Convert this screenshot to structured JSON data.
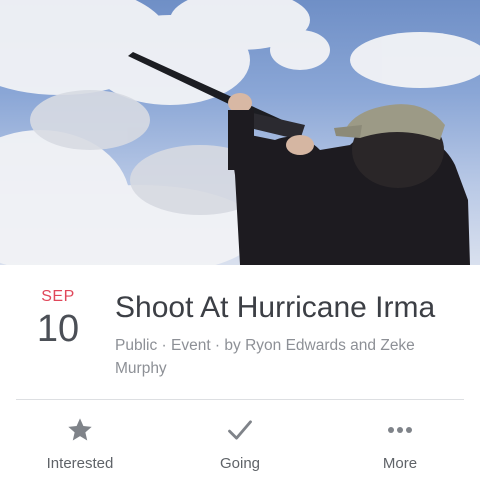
{
  "event": {
    "month": "SEP",
    "day": "10",
    "title": "Shoot At Hurricane Irma",
    "meta": "Public · Event · by Ryon Edwards and Zeke Murphy"
  },
  "actions": [
    {
      "label": "Interested",
      "icon": "star-icon"
    },
    {
      "label": "Going",
      "icon": "checkmark-icon"
    },
    {
      "label": "More",
      "icon": "more-dots-icon"
    }
  ],
  "colors": {
    "month_accent": "#e0475a",
    "icon_gray": "#7f8389",
    "divider": "#dddfe2"
  }
}
